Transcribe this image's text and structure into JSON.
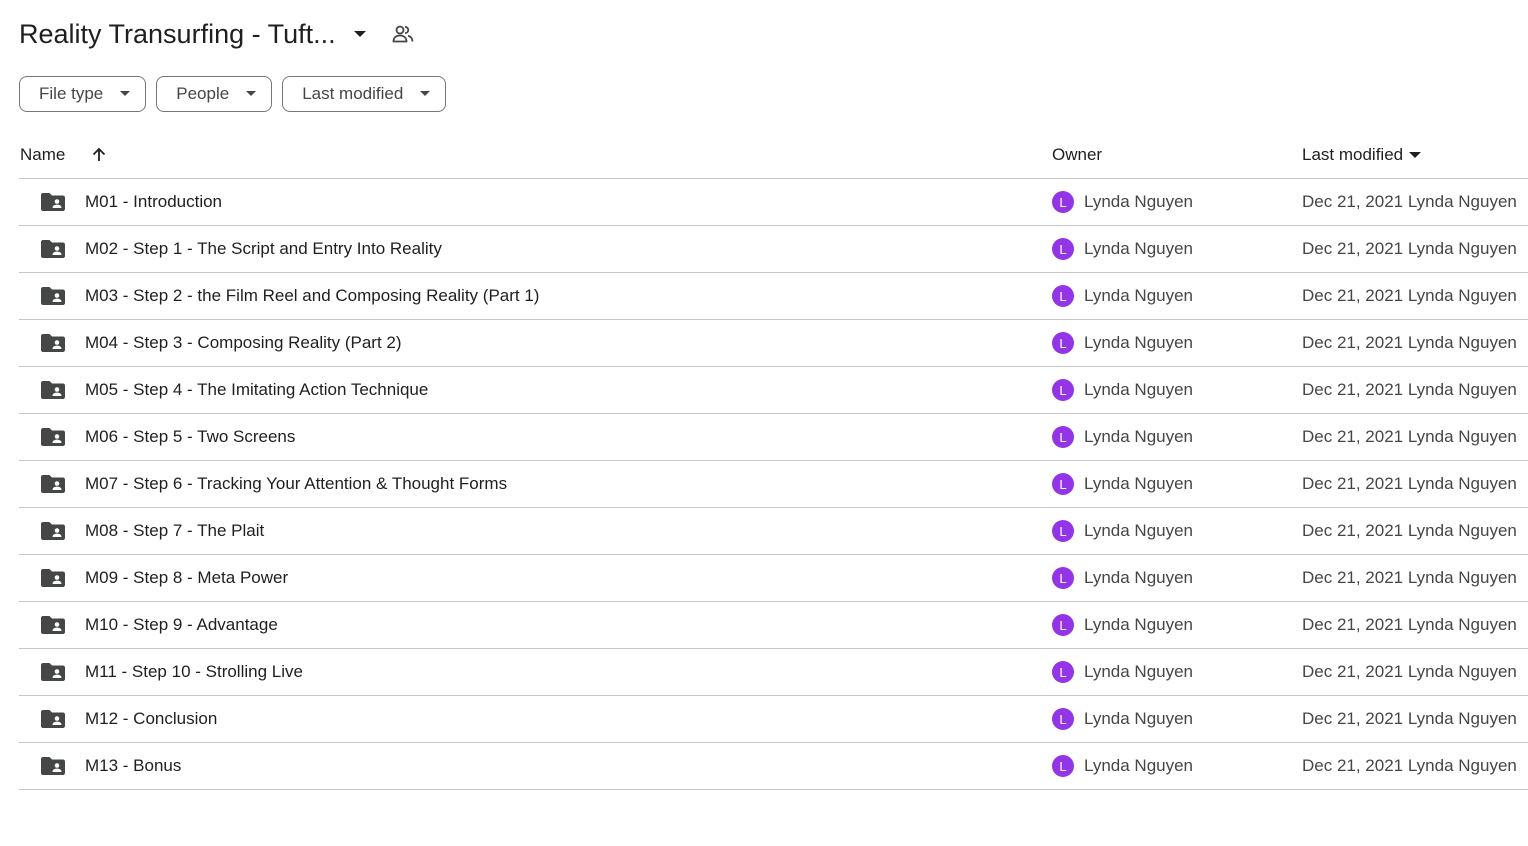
{
  "header": {
    "title": "Reality Transurfing - Tuft..."
  },
  "filters": [
    {
      "label": "File type"
    },
    {
      "label": "People"
    },
    {
      "label": "Last modified"
    }
  ],
  "columns": {
    "name": "Name",
    "owner": "Owner",
    "last_modified": "Last modified"
  },
  "rows": [
    {
      "name": "M01 - Introduction",
      "owner_initial": "L",
      "owner": "Lynda Nguyen",
      "modified": "Dec 21, 2021 Lynda Nguyen"
    },
    {
      "name": "M02 - Step 1 - The Script and Entry Into Reality",
      "owner_initial": "L",
      "owner": "Lynda Nguyen",
      "modified": "Dec 21, 2021 Lynda Nguyen"
    },
    {
      "name": "M03 - Step 2 - the Film Reel and Composing Reality (Part 1)",
      "owner_initial": "L",
      "owner": "Lynda Nguyen",
      "modified": "Dec 21, 2021 Lynda Nguyen"
    },
    {
      "name": "M04 - Step 3 - Composing Reality (Part 2)",
      "owner_initial": "L",
      "owner": "Lynda Nguyen",
      "modified": "Dec 21, 2021 Lynda Nguyen"
    },
    {
      "name": "M05 - Step 4 - The Imitating Action Technique",
      "owner_initial": "L",
      "owner": "Lynda Nguyen",
      "modified": "Dec 21, 2021 Lynda Nguyen"
    },
    {
      "name": "M06 - Step 5 - Two Screens",
      "owner_initial": "L",
      "owner": "Lynda Nguyen",
      "modified": "Dec 21, 2021 Lynda Nguyen"
    },
    {
      "name": "M07 - Step 6 - Tracking Your Attention & Thought Forms",
      "owner_initial": "L",
      "owner": "Lynda Nguyen",
      "modified": "Dec 21, 2021 Lynda Nguyen"
    },
    {
      "name": "M08 - Step 7 - The Plait",
      "owner_initial": "L",
      "owner": "Lynda Nguyen",
      "modified": "Dec 21, 2021 Lynda Nguyen"
    },
    {
      "name": "M09 - Step 8 - Meta Power",
      "owner_initial": "L",
      "owner": "Lynda Nguyen",
      "modified": "Dec 21, 2021 Lynda Nguyen"
    },
    {
      "name": "M10 - Step 9 - Advantage",
      "owner_initial": "L",
      "owner": "Lynda Nguyen",
      "modified": "Dec 21, 2021 Lynda Nguyen"
    },
    {
      "name": "M11 - Step 10 - Strolling Live",
      "owner_initial": "L",
      "owner": "Lynda Nguyen",
      "modified": "Dec 21, 2021 Lynda Nguyen"
    },
    {
      "name": "M12 - Conclusion",
      "owner_initial": "L",
      "owner": "Lynda Nguyen",
      "modified": "Dec 21, 2021 Lynda Nguyen"
    },
    {
      "name": "M13 - Bonus",
      "owner_initial": "L",
      "owner": "Lynda Nguyen",
      "modified": "Dec 21, 2021 Lynda Nguyen"
    }
  ],
  "colors": {
    "avatar_bg": "#9334e6",
    "folder_icon": "#444746",
    "divider": "#c4c7c5"
  },
  "icons": {
    "row_icon": "shared-folder-icon",
    "title_caret": "caret-down-icon",
    "title_share": "people-icon",
    "sort_name": "arrow-up-icon",
    "sort_modified": "caret-down-icon"
  }
}
